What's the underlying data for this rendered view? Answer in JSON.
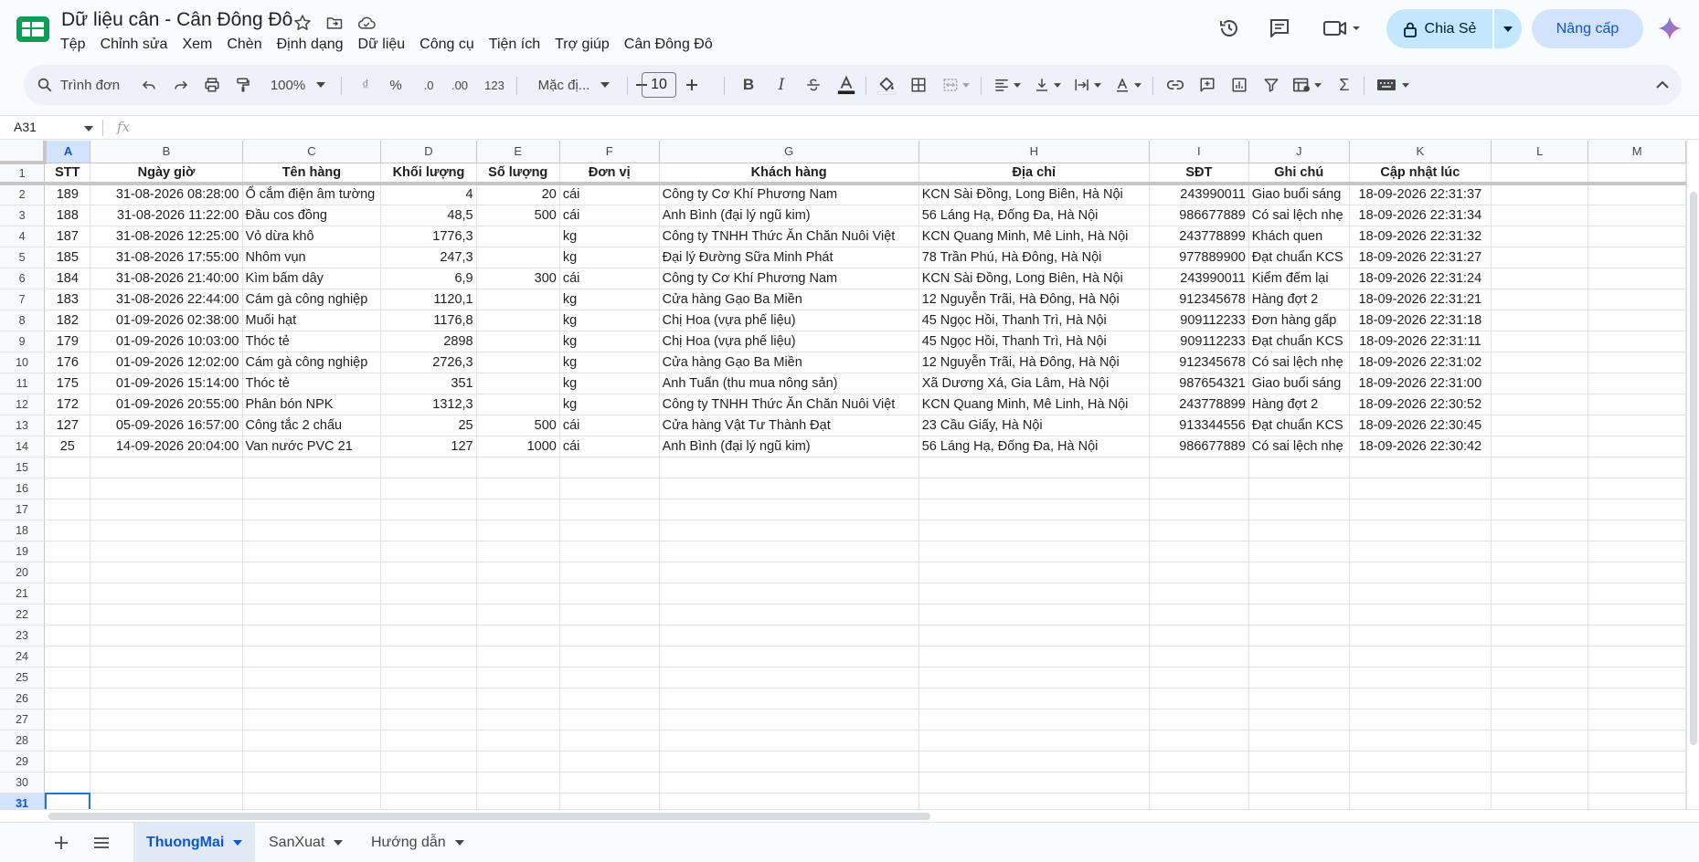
{
  "app": {
    "doc_title": "Dữ liệu cân - Cân Đông Đô",
    "menu": [
      "Tệp",
      "Chỉnh sửa",
      "Xem",
      "Chèn",
      "Định dạng",
      "Dữ liệu",
      "Công cụ",
      "Tiện ích",
      "Trợ giúp",
      "Cân Đông Đô"
    ],
    "share_label": "Chia Sẻ",
    "upgrade_label": "Nâng cấp"
  },
  "toolbar": {
    "search_placeholder": "Trình đơn",
    "zoom": "100%",
    "currency_label": "₫",
    "percent_label": "%",
    "dec_decrease_label": ".0",
    "dec_increase_label": ".00",
    "number_format_label": "123",
    "font_label": "Mặc đị...",
    "font_size": "10"
  },
  "formula_bar": {
    "name_box": "A31",
    "fx_label": "fx"
  },
  "grid": {
    "columns": [
      "A",
      "B",
      "C",
      "D",
      "E",
      "F",
      "G",
      "H",
      "I",
      "J",
      "K",
      "L",
      "M"
    ],
    "selected_column": "A",
    "header_row": [
      "STT",
      "Ngày giờ",
      "Tên hàng",
      "Khối lượng",
      "Số lượng",
      "Đơn vị",
      "Khách hàng",
      "Địa chỉ",
      "SĐT",
      "Ghi chú",
      "Cập nhật lúc",
      "",
      ""
    ],
    "rows": [
      [
        "189",
        "31-08-2026 08:28:00",
        "Ổ cắm điện âm tường",
        "4",
        "20",
        "cái",
        "Công ty Cơ Khí Phương Nam",
        "KCN Sài Đồng, Long Biên, Hà Nội",
        "243990011",
        "Giao buổi sáng",
        "18-09-2026 22:31:37",
        "",
        ""
      ],
      [
        "188",
        "31-08-2026 11:22:00",
        "Đầu cos đồng",
        "48,5",
        "500",
        "cái",
        "Anh Bình (đại lý ngũ kim)",
        "56 Láng Hạ, Đống Đa, Hà Nội",
        "986677889",
        "Có sai lệch nhẹ",
        "18-09-2026 22:31:34",
        "",
        ""
      ],
      [
        "187",
        "31-08-2026 12:25:00",
        "Vỏ dừa khô",
        "1776,3",
        "",
        "kg",
        "Công ty TNHH Thức Ăn Chăn Nuôi Việt",
        "KCN Quang Minh, Mê Linh, Hà Nội",
        "243778899",
        "Khách quen",
        "18-09-2026 22:31:32",
        "",
        ""
      ],
      [
        "185",
        "31-08-2026 17:55:00",
        "Nhôm vụn",
        "247,3",
        "",
        "kg",
        "Đại lý Đường Sữa Minh Phát",
        "78 Trần Phú, Hà Đông, Hà Nội",
        "977889900",
        "Đạt chuẩn KCS",
        "18-09-2026 22:31:27",
        "",
        ""
      ],
      [
        "184",
        "31-08-2026 21:40:00",
        "Kìm bấm dây",
        "6,9",
        "300",
        "cái",
        "Công ty Cơ Khí Phương Nam",
        "KCN Sài Đồng, Long Biên, Hà Nội",
        "243990011",
        "Kiểm đếm lại",
        "18-09-2026 22:31:24",
        "",
        ""
      ],
      [
        "183",
        "31-08-2026 22:44:00",
        "Cám gà công nghiệp",
        "1120,1",
        "",
        "kg",
        "Cửa hàng Gạo Ba Miền",
        "12 Nguyễn Trãi, Hà Đông, Hà Nội",
        "912345678",
        "Hàng đợt 2",
        "18-09-2026 22:31:21",
        "",
        ""
      ],
      [
        "182",
        "01-09-2026 02:38:00",
        "Muối hạt",
        "1176,8",
        "",
        "kg",
        "Chị Hoa (vựa phế liệu)",
        "45 Ngọc Hồi, Thanh Trì, Hà Nội",
        "909112233",
        "Đơn hàng gấp",
        "18-09-2026 22:31:18",
        "",
        ""
      ],
      [
        "179",
        "01-09-2026 10:03:00",
        "Thóc tẻ",
        "2898",
        "",
        "kg",
        "Chị Hoa (vựa phế liệu)",
        "45 Ngọc Hồi, Thanh Trì, Hà Nội",
        "909112233",
        "Đạt chuẩn KCS",
        "18-09-2026 22:31:11",
        "",
        ""
      ],
      [
        "176",
        "01-09-2026 12:02:00",
        "Cám gà công nghiệp",
        "2726,3",
        "",
        "kg",
        "Cửa hàng Gạo Ba Miền",
        "12 Nguyễn Trãi, Hà Đông, Hà Nội",
        "912345678",
        "Có sai lệch nhẹ",
        "18-09-2026 22:31:02",
        "",
        ""
      ],
      [
        "175",
        "01-09-2026 15:14:00",
        "Thóc tẻ",
        "351",
        "",
        "kg",
        "Anh Tuấn (thu mua nông sản)",
        "Xã Dương Xá, Gia Lâm, Hà Nội",
        "987654321",
        "Giao buổi sáng",
        "18-09-2026 22:31:00",
        "",
        ""
      ],
      [
        "172",
        "01-09-2026 20:55:00",
        "Phân bón NPK",
        "1312,3",
        "",
        "kg",
        "Công ty TNHH Thức Ăn Chăn Nuôi Việt",
        "KCN Quang Minh, Mê Linh, Hà Nội",
        "243778899",
        "Hàng đợt 2",
        "18-09-2026 22:30:52",
        "",
        ""
      ],
      [
        "127",
        "05-09-2026 16:57:00",
        "Công tắc 2 chấu",
        "25",
        "500",
        "cái",
        "Cửa hàng Vật Tư Thành Đạt",
        "23 Cầu Giấy, Hà Nội",
        "913344556",
        "Đạt chuẩn KCS",
        "18-09-2026 22:30:45",
        "",
        ""
      ],
      [
        "25",
        "14-09-2026 20:04:00",
        "Van nước PVC 21",
        "127",
        "1000",
        "cái",
        "Anh Bình (đại lý ngũ kim)",
        "56 Láng Hạ, Đống Đa, Hà Nội",
        "986677889",
        "Có sai lệch nhẹ",
        "18-09-2026 22:30:42",
        "",
        ""
      ]
    ],
    "row_numbers": [
      "1",
      "2",
      "3",
      "4",
      "5",
      "6",
      "7",
      "8",
      "9",
      "10",
      "11",
      "12",
      "13",
      "14",
      "15",
      "16",
      "17",
      "18",
      "19",
      "20",
      "21",
      "22",
      "23",
      "24",
      "25",
      "26",
      "27",
      "28",
      "29",
      "30",
      "31"
    ],
    "selected_row": "31"
  },
  "sheets": {
    "tabs": [
      "ThuongMai",
      "SanXuat",
      "Hướng dẫn"
    ],
    "active": "ThuongMai"
  },
  "colors": {
    "accent": "#0b57d0",
    "selection": "#1a73e8",
    "share_bg": "#c2e7ff",
    "upgrade_bg": "#d3e3fd",
    "toolbar_bg": "#edf2fa",
    "logo_green": "#0f9d58"
  },
  "icons": [
    "sheets-logo-icon",
    "star-icon",
    "move-folder-icon",
    "cloud-saved-icon",
    "history-icon",
    "comment-icon",
    "video-call-icon",
    "lock-icon",
    "gemini-icon"
  ]
}
